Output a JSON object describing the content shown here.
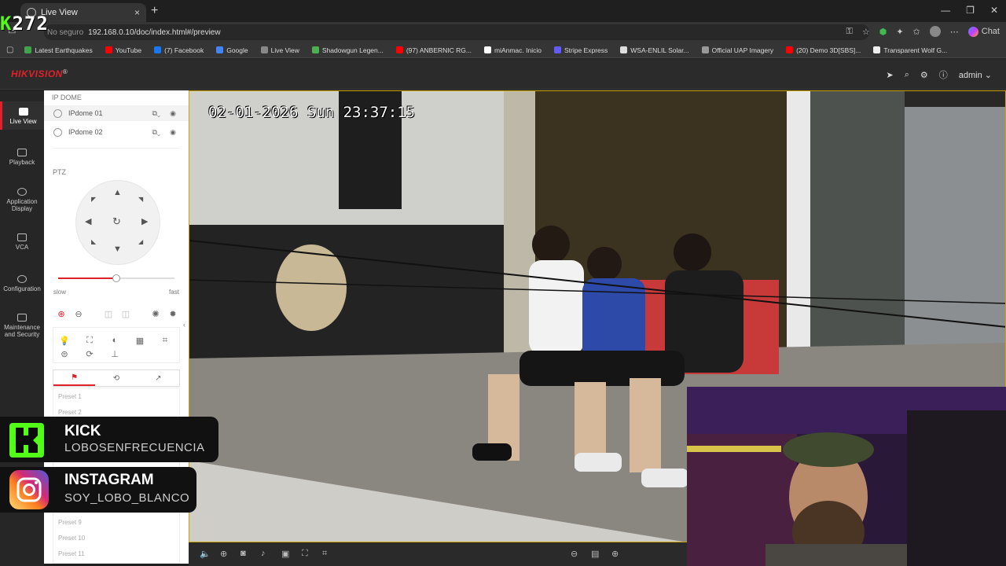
{
  "browser": {
    "tab_title": "Live View",
    "tab_close": "×",
    "new_tab": "+",
    "window_controls": [
      "—",
      "❐",
      "✕"
    ],
    "address_security": "No seguro",
    "address_url": "192.168.0.10/doc/index.html#/preview",
    "chat_label": "Chat",
    "bookmarks": [
      {
        "label": "Latest Earthquakes",
        "color": "#3fa34d"
      },
      {
        "label": "YouTube",
        "color": "#ff0000"
      },
      {
        "label": "(7) Facebook",
        "color": "#1877f2"
      },
      {
        "label": "Google",
        "color": "#4285f4"
      },
      {
        "label": "Live View",
        "color": "#888888"
      },
      {
        "label": "Shadowgun Legen...",
        "color": "#4caf50"
      },
      {
        "label": "(97) ANBERNIC RG...",
        "color": "#ff0000"
      },
      {
        "label": "miAnmac. Inicio",
        "color": "#ffffff"
      },
      {
        "label": "Stripe Express",
        "color": "#635bff"
      },
      {
        "label": "WSA-ENLIL Solar...",
        "color": "#dddddd"
      },
      {
        "label": "Official UAP Imagery",
        "color": "#999999"
      },
      {
        "label": "(20) Demo 3D[SBS]...",
        "color": "#ff0000"
      },
      {
        "label": "Transparent Wolf G...",
        "color": "#eeeeee"
      }
    ]
  },
  "overlay_counter": {
    "k": "K",
    "number": "272"
  },
  "app": {
    "brand": "HIKVISION",
    "brand_mark": "®",
    "user": "admin"
  },
  "nav": [
    {
      "label": "Live View"
    },
    {
      "label": "Playback"
    },
    {
      "label": "Application Display"
    },
    {
      "label": "VCA"
    },
    {
      "label": "Configuration"
    },
    {
      "label": "Maintenance and Security"
    }
  ],
  "panel": {
    "device_group": "IP DOME",
    "cameras": [
      "IPdome 01",
      "IPdome 02"
    ],
    "ptz_title": "PTZ",
    "speed_slow": "slow",
    "speed_fast": "fast",
    "speed_level": 0.5,
    "presets_visible": [
      "Preset 1",
      "Preset 2",
      "Preset 9",
      "Preset 10",
      "Preset 11"
    ]
  },
  "video": {
    "osd_timestamp": "02-01-2026 Sun 23:37:15"
  },
  "social": {
    "kick_title": "KICK",
    "kick_handle": "LOBOSENFRECUENCIA",
    "insta_title": "INSTAGRAM",
    "insta_handle": "SOY_LOBO_BLANCO"
  },
  "colors": {
    "accent": "#e02129",
    "kick_green": "#53fc18"
  }
}
